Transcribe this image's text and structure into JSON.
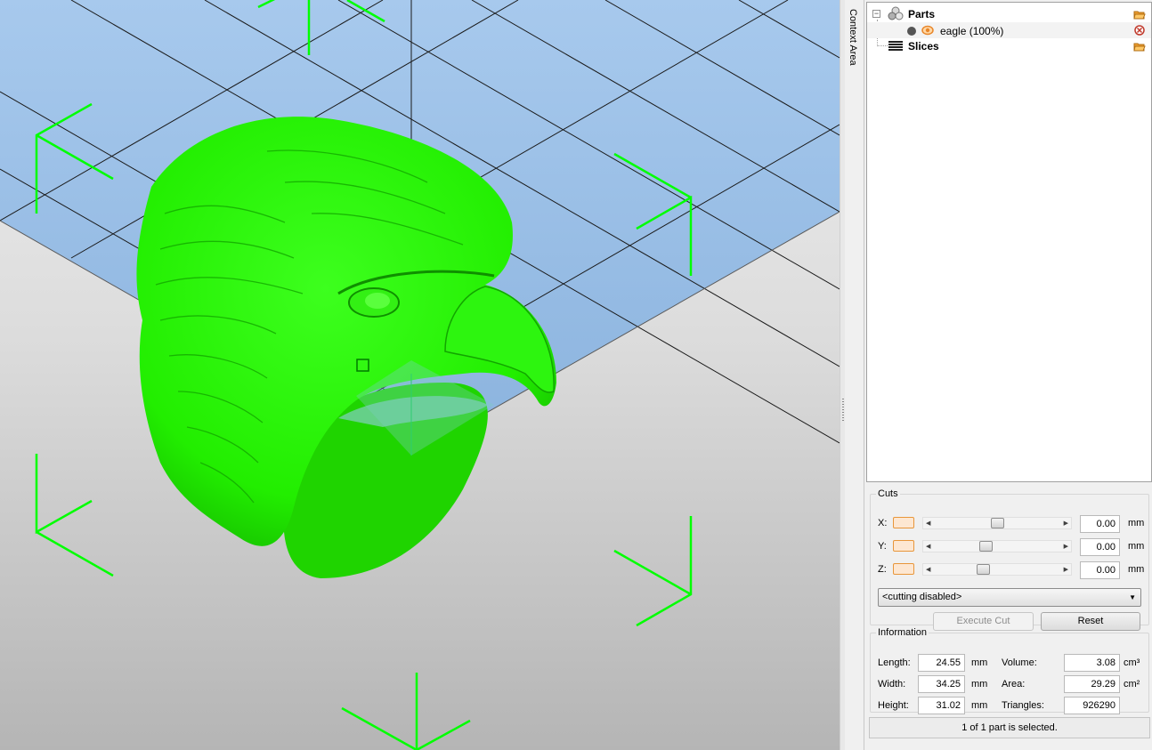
{
  "context_area": {
    "label": "Context Area"
  },
  "tree": {
    "parts": {
      "label": "Parts",
      "expander": "−",
      "icon": "parts-icon"
    },
    "eagle": {
      "label": "eagle (100%)",
      "icon": "eye-icon"
    },
    "slices": {
      "label": "Slices",
      "icon": "slices-icon"
    }
  },
  "cuts": {
    "title": "Cuts",
    "x": {
      "label": "X:",
      "value": "0.00",
      "unit": "mm",
      "slider_position": 0.5
    },
    "y": {
      "label": "Y:",
      "value": "0.00",
      "unit": "mm",
      "slider_position": 0.4
    },
    "z": {
      "label": "Z:",
      "value": "0.00",
      "unit": "mm",
      "slider_position": 0.37
    },
    "mode": "<cutting disabled>",
    "execute_label": "Execute Cut",
    "reset_label": "Reset"
  },
  "info": {
    "title": "Information",
    "length_label": "Length:",
    "length_value": "24.55",
    "length_unit": "mm",
    "width_label": "Width:",
    "width_value": "34.25",
    "width_unit": "mm",
    "height_label": "Height:",
    "height_value": "31.02",
    "height_unit": "mm",
    "volume_label": "Volume:",
    "volume_value": "3.08",
    "volume_unit": "cm³",
    "area_label": "Area:",
    "area_value": "29.29",
    "area_unit": "cm²",
    "triangles_label": "Triangles:",
    "triangles_value": "926290"
  },
  "status": {
    "text": "1 of 1 part is selected."
  },
  "colors": {
    "model": "#22ee00",
    "platform": "#9dc3ea",
    "bbox": "#00ff00",
    "accent": "#e8963a"
  }
}
